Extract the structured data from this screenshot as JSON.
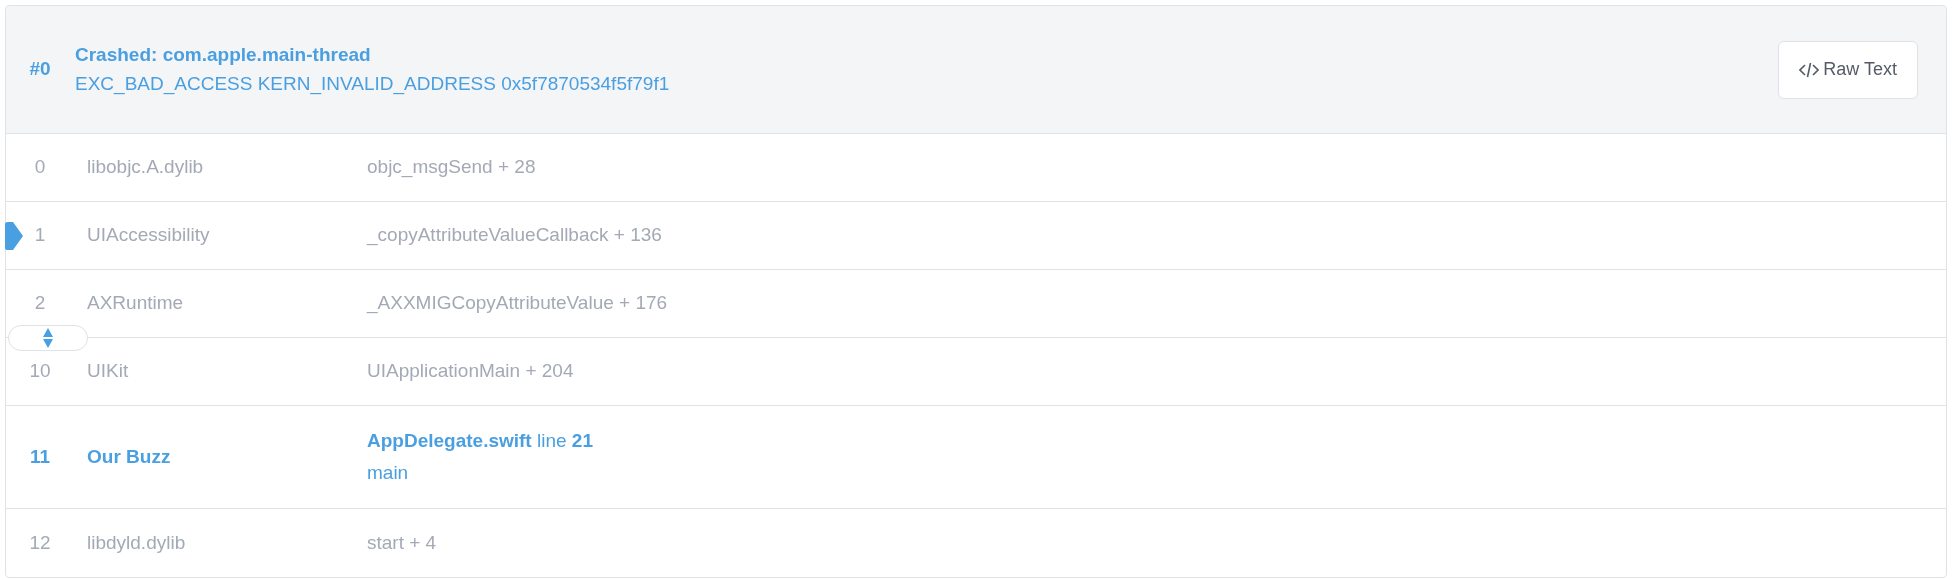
{
  "thread": {
    "index": "#0",
    "title": "Crashed: com.apple.main-thread",
    "exception": "EXC_BAD_ACCESS KERN_INVALID_ADDRESS 0x5f7870534f5f79f1",
    "raw_button": "Raw Text"
  },
  "frames": [
    {
      "kind": "system",
      "number": "0",
      "library": "libobjc.A.dylib",
      "symbol": "objc_msgSend + 28",
      "selected": false
    },
    {
      "kind": "system",
      "number": "1",
      "library": "UIAccessibility",
      "symbol": "_copyAttributeValueCallback + 136",
      "selected": true
    },
    {
      "kind": "system",
      "number": "2",
      "library": "AXRuntime",
      "symbol": "_AXXMIGCopyAttributeValue + 176",
      "selected": false
    },
    {
      "kind": "collapsed"
    },
    {
      "kind": "system",
      "number": "10",
      "library": "UIKit",
      "symbol": "UIApplicationMain + 204",
      "selected": false
    },
    {
      "kind": "app",
      "number": "11",
      "library": "Our Buzz",
      "symbol": "**AppDelegate.swift** line **21**",
      "function": "main",
      "selected": false
    },
    {
      "kind": "system",
      "number": "12",
      "library": "libdyld.dylib",
      "symbol": "start + 4",
      "selected": false
    }
  ]
}
